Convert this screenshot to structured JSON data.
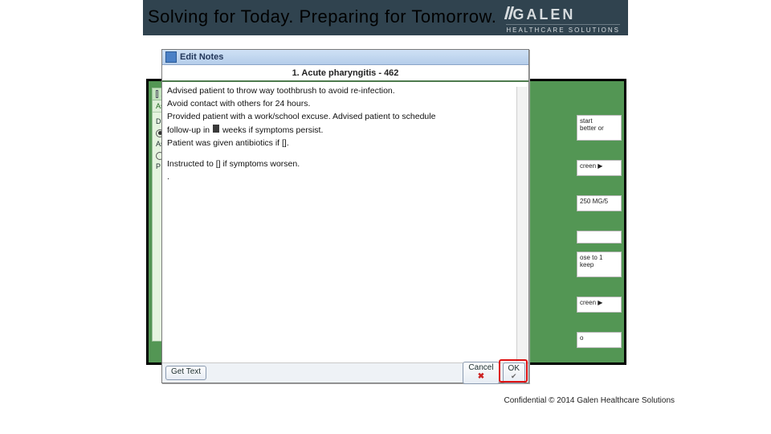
{
  "slide": {
    "tagline": "Solving for Today. Preparing for Tomorrow.",
    "footer": "Confidential © 2014 Galen Healthcare Solutions"
  },
  "logo": {
    "name": "GALEN",
    "sub": "HEALTHCARE SOLUTIONS"
  },
  "bg_app": {
    "tab_label": "Assessment/P",
    "subsection": "Assessment/Plan",
    "format_label": "Display Format:",
    "radio1": "Plan by Assessm",
    "radio2": "Consolidated P"
  },
  "right_fragments": {
    "r1": "start",
    "r2": "better or",
    "r3": "creen ▶",
    "r4": "250 MG/5",
    "r5": "ose to 1",
    "r6": "keep",
    "r7": "creen ▶",
    "r8": "o"
  },
  "dialog": {
    "window_title": "Edit Notes",
    "heading": "1. Acute pharyngitis - 462",
    "lines": {
      "l1": "Advised patient to throw way toothbrush to avoid re-infection.",
      "l2": "Avoid contact with others for 24 hours.",
      "l3a": "Provided patient with a work/school excuse. Advised patient to schedule",
      "l3b": "follow-up in ",
      "l3c": " weeks if symptoms persist.",
      "l4": "Patient was given antibiotics if [].",
      "l5": "Instructed to [] if symptoms worsen.",
      "l6": "."
    },
    "buttons": {
      "get_text": "Get Text",
      "cancel": "Cancel",
      "ok": "OK"
    }
  }
}
